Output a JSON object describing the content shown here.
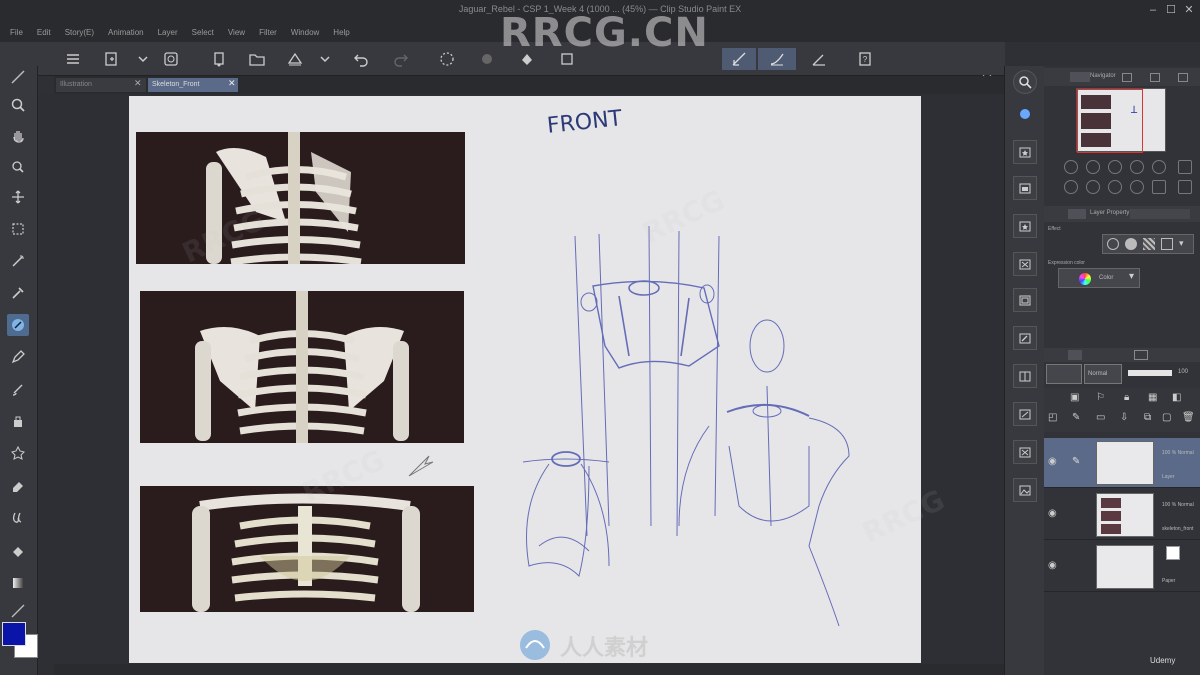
{
  "window": {
    "title": "Jaguar_Rebel - CSP 1_Week 4 (1000 ... (45%) — Clip Studio Paint EX",
    "controls": [
      "minimize",
      "maximize",
      "close"
    ]
  },
  "menu": [
    "File",
    "Edit",
    "Story(E)",
    "Animation",
    "Layer",
    "Select",
    "View",
    "Filter",
    "Window",
    "Help"
  ],
  "tabs": [
    {
      "label": "Illustration",
      "active": false
    },
    {
      "label": "Skeleton_Front",
      "active": true
    }
  ],
  "canvas": {
    "handwriting": "FRONT"
  },
  "colors": {
    "main_color": "#0b14a8",
    "sub_color": "#ffffff",
    "accent": "#5a6a88"
  },
  "right_panel": {
    "navigator_label": "Navigator",
    "layer_property_label": "Layer Property",
    "effect_label": "Effect",
    "expression_color_label": "Expression color",
    "expression_color_value": "Color",
    "blend_mode": "Normal",
    "opacity": "100",
    "layers": [
      {
        "name": "100 % Normal",
        "sub": "Layer",
        "active": true
      },
      {
        "name": "100 % Normal",
        "sub": "skeleton_front",
        "active": false
      },
      {
        "name": "",
        "sub": "Paper",
        "active": false
      }
    ]
  },
  "watermark": {
    "main": "RRCG.CN",
    "bottom": "人人素材",
    "udemy": "Udemy"
  }
}
